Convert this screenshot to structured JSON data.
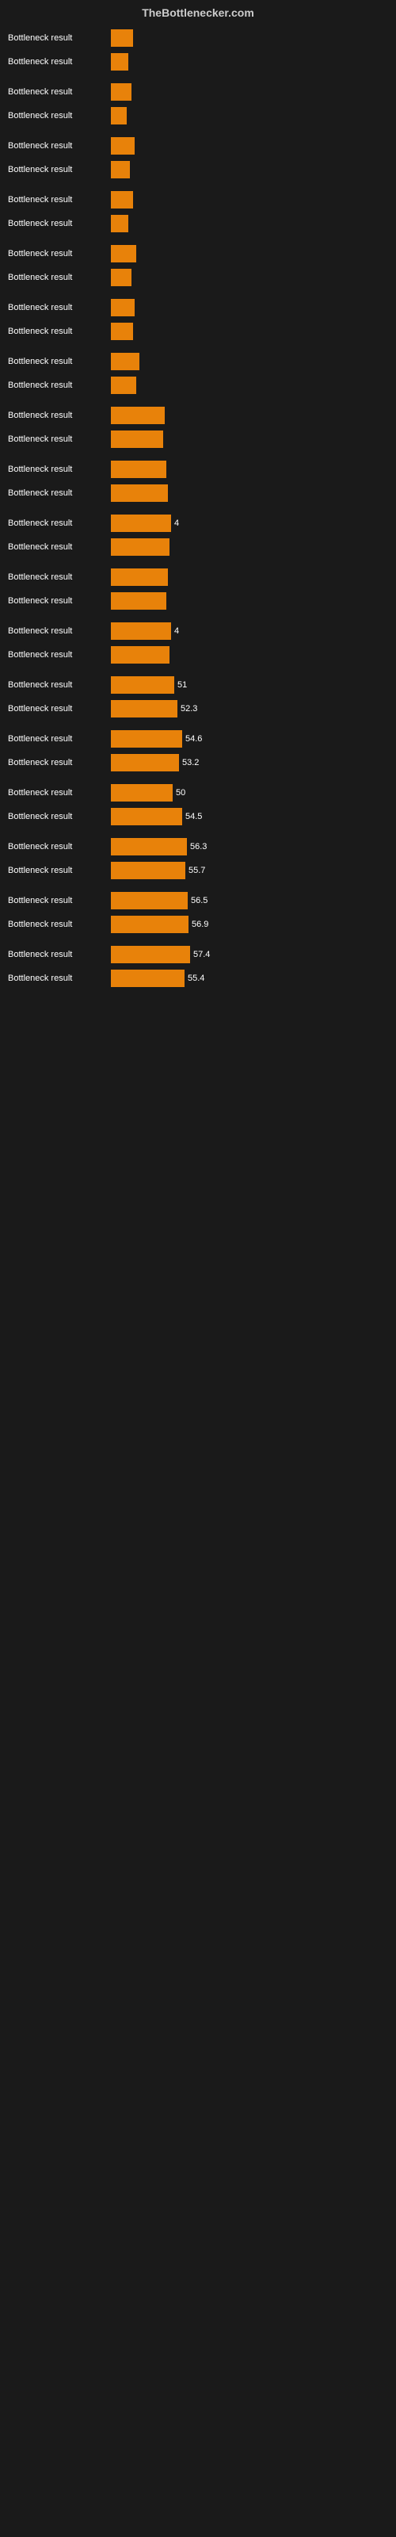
{
  "header": {
    "title": "TheBottlenecker.com"
  },
  "bars": [
    {
      "label": "Bottleneck result",
      "value": null,
      "width": 28
    },
    {
      "label": "Bottleneck result",
      "value": null,
      "width": 22
    },
    {
      "label": "Bottleneck result",
      "value": null,
      "width": 26
    },
    {
      "label": "Bottleneck result",
      "value": null,
      "width": 20
    },
    {
      "label": "Bottleneck result",
      "value": null,
      "width": 30
    },
    {
      "label": "Bottleneck result",
      "value": null,
      "width": 24
    },
    {
      "label": "Bottleneck result",
      "value": null,
      "width": 28
    },
    {
      "label": "Bottleneck result",
      "value": null,
      "width": 22
    },
    {
      "label": "Bottleneck result",
      "value": null,
      "width": 32
    },
    {
      "label": "Bottleneck result",
      "value": null,
      "width": 26
    },
    {
      "label": "Bottleneck result",
      "value": null,
      "width": 30
    },
    {
      "label": "Bottleneck result",
      "value": null,
      "width": 28
    },
    {
      "label": "Bottleneck result",
      "value": null,
      "width": 36
    },
    {
      "label": "Bottleneck result",
      "value": null,
      "width": 32
    },
    {
      "label": "Bottleneck result",
      "value": null,
      "width": 68
    },
    {
      "label": "Bottleneck result",
      "value": null,
      "width": 66
    },
    {
      "label": "Bottleneck result",
      "value": null,
      "width": 70
    },
    {
      "label": "Bottleneck result",
      "value": null,
      "width": 72
    },
    {
      "label": "Bottleneck result",
      "value": "4",
      "width": 76
    },
    {
      "label": "Bottleneck result",
      "value": null,
      "width": 74
    },
    {
      "label": "Bottleneck result",
      "value": null,
      "width": 72
    },
    {
      "label": "Bottleneck result",
      "value": null,
      "width": 70
    },
    {
      "label": "Bottleneck result",
      "value": "4",
      "width": 76
    },
    {
      "label": "Bottleneck result",
      "value": null,
      "width": 74
    },
    {
      "label": "Bottleneck result",
      "value": "51",
      "width": 80
    },
    {
      "label": "Bottleneck result",
      "value": "52.3",
      "width": 84
    },
    {
      "label": "Bottleneck result",
      "value": "54.6",
      "width": 90
    },
    {
      "label": "Bottleneck result",
      "value": "53.2",
      "width": 86
    },
    {
      "label": "Bottleneck result",
      "value": "50",
      "width": 78
    },
    {
      "label": "Bottleneck result",
      "value": "54.5",
      "width": 90
    },
    {
      "label": "Bottleneck result",
      "value": "56.3",
      "width": 96
    },
    {
      "label": "Bottleneck result",
      "value": "55.7",
      "width": 94
    },
    {
      "label": "Bottleneck result",
      "value": "56.5",
      "width": 97
    },
    {
      "label": "Bottleneck result",
      "value": "56.9",
      "width": 98
    },
    {
      "label": "Bottleneck result",
      "value": "57.4",
      "width": 100
    },
    {
      "label": "Bottleneck result",
      "value": "55.4",
      "width": 93
    }
  ]
}
